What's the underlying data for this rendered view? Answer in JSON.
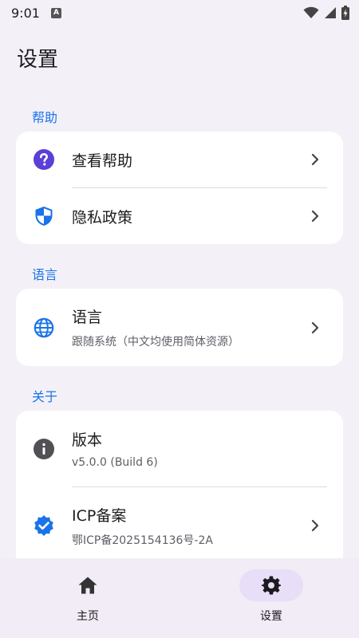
{
  "status_bar": {
    "time": "9:01",
    "notification_icon": "a-letter-icon",
    "icons": [
      "wifi-icon",
      "signal-icon",
      "battery-charging-icon"
    ]
  },
  "page": {
    "title": "设置"
  },
  "sections": {
    "help": {
      "label": "帮助",
      "items": [
        {
          "title": "查看帮助",
          "icon": "help-circle-icon"
        },
        {
          "title": "隐私政策",
          "icon": "shield-icon"
        }
      ]
    },
    "language": {
      "label": "语言",
      "items": [
        {
          "title": "语言",
          "subtitle": "跟随系统（中文均使用简体资源）",
          "icon": "globe-icon"
        }
      ]
    },
    "about": {
      "label": "关于",
      "items": [
        {
          "title": "版本",
          "subtitle": "v5.0.0 (Build 6)",
          "icon": "info-icon"
        },
        {
          "title": "ICP备案",
          "subtitle": "鄂ICP备2025154136号-2A",
          "icon": "verified-badge-icon"
        }
      ]
    }
  },
  "bottom_nav": {
    "items": [
      {
        "label": "主页",
        "icon": "home-icon",
        "active": false
      },
      {
        "label": "设置",
        "icon": "gear-icon",
        "active": true
      }
    ]
  },
  "colors": {
    "background": "#f3f1f7",
    "accent": "#1a73e8",
    "help_icon": "#5b3fd6",
    "card": "#ffffff",
    "nav_active_pill": "#e8def8",
    "nav_background": "#f1ecf5"
  }
}
